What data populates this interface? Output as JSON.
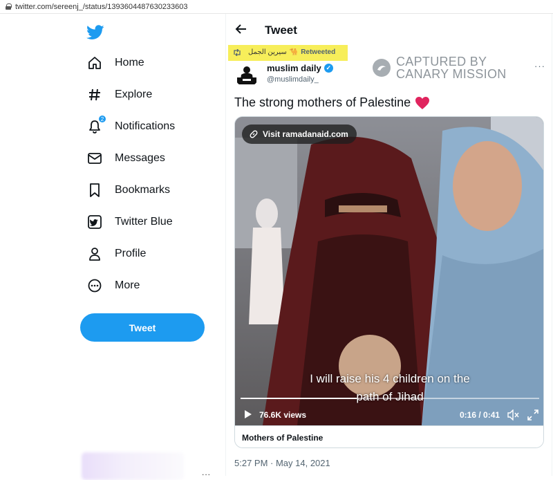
{
  "browser": {
    "url": "twitter.com/sereenj_/status/1393604487630233603"
  },
  "sidebar": {
    "logo": "twitter-bird-icon",
    "items": [
      {
        "label": "Home",
        "icon": "home-icon"
      },
      {
        "label": "Explore",
        "icon": "hashtag-icon"
      },
      {
        "label": "Notifications",
        "icon": "bell-icon",
        "badge": "2"
      },
      {
        "label": "Messages",
        "icon": "envelope-icon"
      },
      {
        "label": "Bookmarks",
        "icon": "bookmark-icon"
      },
      {
        "label": "Twitter Blue",
        "icon": "twitter-blue-icon"
      },
      {
        "label": "Profile",
        "icon": "person-icon"
      },
      {
        "label": "More",
        "icon": "more-circle-icon"
      }
    ],
    "tweet_button": "Tweet",
    "account_more": "..."
  },
  "main": {
    "header_title": "Tweet",
    "retweet": {
      "name": "سيرين الجمل",
      "camel": "🐪",
      "label": "Retweeted"
    },
    "watermark": {
      "line1": "CAPTURED BY",
      "line2": "CANARY MISSION"
    },
    "author": {
      "display_name": "muslim daily",
      "handle": "@muslimdaily_"
    },
    "more": "···",
    "text": "The strong mothers of Palestine",
    "video": {
      "link_pill": "Visit ramadanaid.com",
      "subtitle_line1": "I will raise his 4 children on the",
      "subtitle_line2": "path of Jihad",
      "views": "76.6K views",
      "time": "0:16 / 0:41",
      "progress": 0.39
    },
    "card_title": "Mothers of Palestine",
    "timestamp": "5:27 PM · May 14, 2021"
  },
  "colors": {
    "accent": "#1d9bf0",
    "highlight": "#f7ee5a",
    "heart": "#e0245e"
  }
}
